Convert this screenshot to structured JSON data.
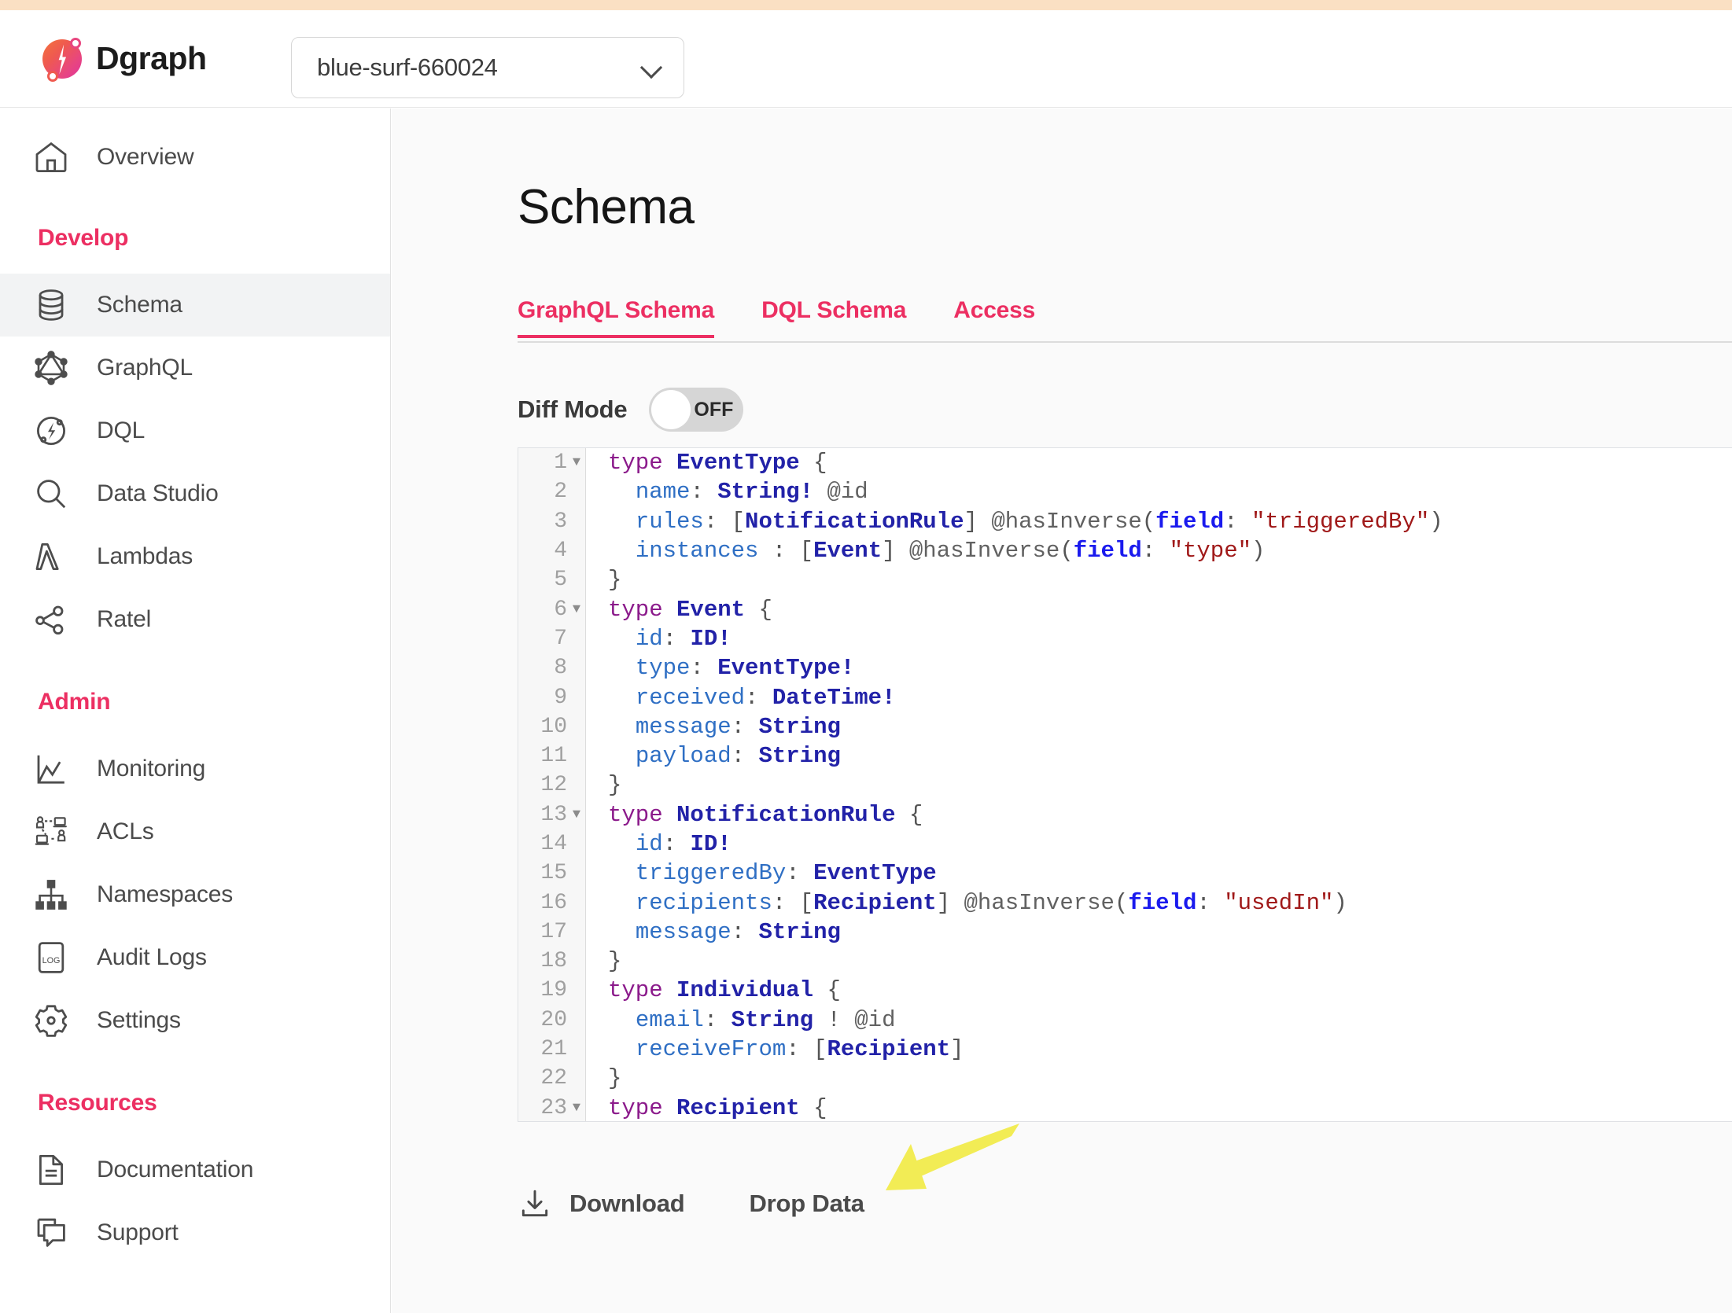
{
  "brand": {
    "name": "Dgraph",
    "logo_icon": "dgraph-logo-icon"
  },
  "backend_selector": {
    "value": "blue-surf-660024",
    "chevron_icon": "chevron-down-icon"
  },
  "sidebar": {
    "groups": [
      {
        "title": "",
        "items": [
          {
            "label": "Overview",
            "icon": "home-icon",
            "active": false
          }
        ]
      },
      {
        "title": "Develop",
        "items": [
          {
            "label": "Schema",
            "icon": "database-icon",
            "active": true
          },
          {
            "label": "GraphQL",
            "icon": "graphql-icon",
            "active": false
          },
          {
            "label": "DQL",
            "icon": "dql-bolt-icon",
            "active": false
          },
          {
            "label": "Data Studio",
            "icon": "magnifier-icon",
            "active": false
          },
          {
            "label": "Lambdas",
            "icon": "lambda-icon",
            "active": false
          },
          {
            "label": "Ratel",
            "icon": "graph-nodes-icon",
            "active": false
          }
        ]
      },
      {
        "title": "Admin",
        "items": [
          {
            "label": "Monitoring",
            "icon": "line-chart-icon",
            "active": false
          },
          {
            "label": "ACLs",
            "icon": "acl-users-icon",
            "active": false
          },
          {
            "label": "Namespaces",
            "icon": "hierarchy-icon",
            "active": false
          },
          {
            "label": "Audit Logs",
            "icon": "log-document-icon",
            "active": false
          },
          {
            "label": "Settings",
            "icon": "gear-icon",
            "active": false
          }
        ]
      },
      {
        "title": "Resources",
        "items": [
          {
            "label": "Documentation",
            "icon": "document-icon",
            "active": false
          },
          {
            "label": "Support",
            "icon": "chat-bubbles-icon",
            "active": false
          }
        ]
      }
    ]
  },
  "main": {
    "page_title": "Schema",
    "tabs": [
      {
        "label": "GraphQL Schema",
        "active": true
      },
      {
        "label": "DQL Schema",
        "active": false
      },
      {
        "label": "Access",
        "active": false
      }
    ],
    "diff_mode": {
      "label": "Diff Mode",
      "state_text": "OFF",
      "on": false
    },
    "editor": {
      "lines": [
        {
          "n": "1",
          "fold": true,
          "tokens": [
            {
              "t": "kw",
              "v": "type"
            },
            {
              "t": "pun",
              "v": " "
            },
            {
              "t": "type",
              "v": "EventType"
            },
            {
              "t": "pun",
              "v": " {"
            }
          ]
        },
        {
          "n": "2",
          "fold": false,
          "tokens": [
            {
              "t": "pun",
              "v": "  "
            },
            {
              "t": "fld",
              "v": "name"
            },
            {
              "t": "pun",
              "v": ": "
            },
            {
              "t": "type",
              "v": "String!"
            },
            {
              "t": "pun",
              "v": " "
            },
            {
              "t": "dir",
              "v": "@id"
            }
          ]
        },
        {
          "n": "3",
          "fold": false,
          "tokens": [
            {
              "t": "pun",
              "v": "  "
            },
            {
              "t": "fld",
              "v": "rules"
            },
            {
              "t": "pun",
              "v": ": ["
            },
            {
              "t": "type",
              "v": "NotificationRule"
            },
            {
              "t": "pun",
              "v": "] "
            },
            {
              "t": "dir",
              "v": "@hasInverse"
            },
            {
              "t": "pun",
              "v": "("
            },
            {
              "t": "arg",
              "v": "field"
            },
            {
              "t": "pun",
              "v": ": "
            },
            {
              "t": "str",
              "v": "\"triggeredBy\""
            },
            {
              "t": "pun",
              "v": ")"
            }
          ]
        },
        {
          "n": "4",
          "fold": false,
          "tokens": [
            {
              "t": "pun",
              "v": "  "
            },
            {
              "t": "fld",
              "v": "instances"
            },
            {
              "t": "pun",
              "v": " : ["
            },
            {
              "t": "type",
              "v": "Event"
            },
            {
              "t": "pun",
              "v": "] "
            },
            {
              "t": "dir",
              "v": "@hasInverse"
            },
            {
              "t": "pun",
              "v": "("
            },
            {
              "t": "arg",
              "v": "field"
            },
            {
              "t": "pun",
              "v": ": "
            },
            {
              "t": "str",
              "v": "\"type\""
            },
            {
              "t": "pun",
              "v": ")"
            }
          ]
        },
        {
          "n": "5",
          "fold": false,
          "tokens": [
            {
              "t": "pun",
              "v": "}"
            }
          ]
        },
        {
          "n": "6",
          "fold": true,
          "tokens": [
            {
              "t": "kw",
              "v": "type"
            },
            {
              "t": "pun",
              "v": " "
            },
            {
              "t": "type",
              "v": "Event"
            },
            {
              "t": "pun",
              "v": " {"
            }
          ]
        },
        {
          "n": "7",
          "fold": false,
          "tokens": [
            {
              "t": "pun",
              "v": "  "
            },
            {
              "t": "fld",
              "v": "id"
            },
            {
              "t": "pun",
              "v": ": "
            },
            {
              "t": "type",
              "v": "ID!"
            }
          ]
        },
        {
          "n": "8",
          "fold": false,
          "tokens": [
            {
              "t": "pun",
              "v": "  "
            },
            {
              "t": "fld",
              "v": "type"
            },
            {
              "t": "pun",
              "v": ": "
            },
            {
              "t": "type",
              "v": "EventType!"
            }
          ]
        },
        {
          "n": "9",
          "fold": false,
          "tokens": [
            {
              "t": "pun",
              "v": "  "
            },
            {
              "t": "fld",
              "v": "received"
            },
            {
              "t": "pun",
              "v": ": "
            },
            {
              "t": "type",
              "v": "DateTime!"
            }
          ]
        },
        {
          "n": "10",
          "fold": false,
          "tokens": [
            {
              "t": "pun",
              "v": "  "
            },
            {
              "t": "fld",
              "v": "message"
            },
            {
              "t": "pun",
              "v": ": "
            },
            {
              "t": "type",
              "v": "String"
            }
          ]
        },
        {
          "n": "11",
          "fold": false,
          "tokens": [
            {
              "t": "pun",
              "v": "  "
            },
            {
              "t": "fld",
              "v": "payload"
            },
            {
              "t": "pun",
              "v": ": "
            },
            {
              "t": "type",
              "v": "String"
            }
          ]
        },
        {
          "n": "12",
          "fold": false,
          "tokens": [
            {
              "t": "pun",
              "v": "}"
            }
          ]
        },
        {
          "n": "13",
          "fold": true,
          "tokens": [
            {
              "t": "kw",
              "v": "type"
            },
            {
              "t": "pun",
              "v": " "
            },
            {
              "t": "type",
              "v": "NotificationRule"
            },
            {
              "t": "pun",
              "v": " {"
            }
          ]
        },
        {
          "n": "14",
          "fold": false,
          "tokens": [
            {
              "t": "pun",
              "v": "  "
            },
            {
              "t": "fld",
              "v": "id"
            },
            {
              "t": "pun",
              "v": ": "
            },
            {
              "t": "type",
              "v": "ID!"
            }
          ]
        },
        {
          "n": "15",
          "fold": false,
          "tokens": [
            {
              "t": "pun",
              "v": "  "
            },
            {
              "t": "fld",
              "v": "triggeredBy"
            },
            {
              "t": "pun",
              "v": ": "
            },
            {
              "t": "type",
              "v": "EventType"
            }
          ]
        },
        {
          "n": "16",
          "fold": false,
          "tokens": [
            {
              "t": "pun",
              "v": "  "
            },
            {
              "t": "fld",
              "v": "recipients"
            },
            {
              "t": "pun",
              "v": ": ["
            },
            {
              "t": "type",
              "v": "Recipient"
            },
            {
              "t": "pun",
              "v": "] "
            },
            {
              "t": "dir",
              "v": "@hasInverse"
            },
            {
              "t": "pun",
              "v": "("
            },
            {
              "t": "arg",
              "v": "field"
            },
            {
              "t": "pun",
              "v": ": "
            },
            {
              "t": "str",
              "v": "\"usedIn\""
            },
            {
              "t": "pun",
              "v": ")"
            }
          ]
        },
        {
          "n": "17",
          "fold": false,
          "tokens": [
            {
              "t": "pun",
              "v": "  "
            },
            {
              "t": "fld",
              "v": "message"
            },
            {
              "t": "pun",
              "v": ": "
            },
            {
              "t": "type",
              "v": "String"
            }
          ]
        },
        {
          "n": "18",
          "fold": false,
          "tokens": [
            {
              "t": "pun",
              "v": "}"
            }
          ]
        },
        {
          "n": "19",
          "fold": false,
          "tokens": [
            {
              "t": "kw",
              "v": "type"
            },
            {
              "t": "pun",
              "v": " "
            },
            {
              "t": "type",
              "v": "Individual"
            },
            {
              "t": "pun",
              "v": " {"
            }
          ]
        },
        {
          "n": "20",
          "fold": false,
          "tokens": [
            {
              "t": "pun",
              "v": "  "
            },
            {
              "t": "fld",
              "v": "email"
            },
            {
              "t": "pun",
              "v": ": "
            },
            {
              "t": "type",
              "v": "String"
            },
            {
              "t": "pun",
              "v": " ! "
            },
            {
              "t": "dir",
              "v": "@id"
            }
          ]
        },
        {
          "n": "21",
          "fold": false,
          "tokens": [
            {
              "t": "pun",
              "v": "  "
            },
            {
              "t": "fld",
              "v": "receiveFrom"
            },
            {
              "t": "pun",
              "v": ": ["
            },
            {
              "t": "type",
              "v": "Recipient"
            },
            {
              "t": "pun",
              "v": "]"
            }
          ]
        },
        {
          "n": "22",
          "fold": false,
          "tokens": [
            {
              "t": "pun",
              "v": "}"
            }
          ]
        },
        {
          "n": "23",
          "fold": true,
          "tokens": [
            {
              "t": "kw",
              "v": "type"
            },
            {
              "t": "pun",
              "v": " "
            },
            {
              "t": "type",
              "v": "Recipient"
            },
            {
              "t": "pun",
              "v": " {"
            }
          ]
        }
      ]
    },
    "actions": [
      {
        "label": "Download",
        "icon": "download-icon"
      },
      {
        "label": "Drop Data",
        "icon": ""
      }
    ]
  },
  "annotation": {
    "arrow_color": "#f2ec55",
    "points_to": "Drop Data"
  },
  "colors": {
    "accent_pink": "#ec2f62",
    "top_strip": "#fae0c3",
    "annotation_yellow": "#f2ec55",
    "sidebar_active_bg": "#f2f3f4",
    "page_bg": "#fafafa"
  }
}
